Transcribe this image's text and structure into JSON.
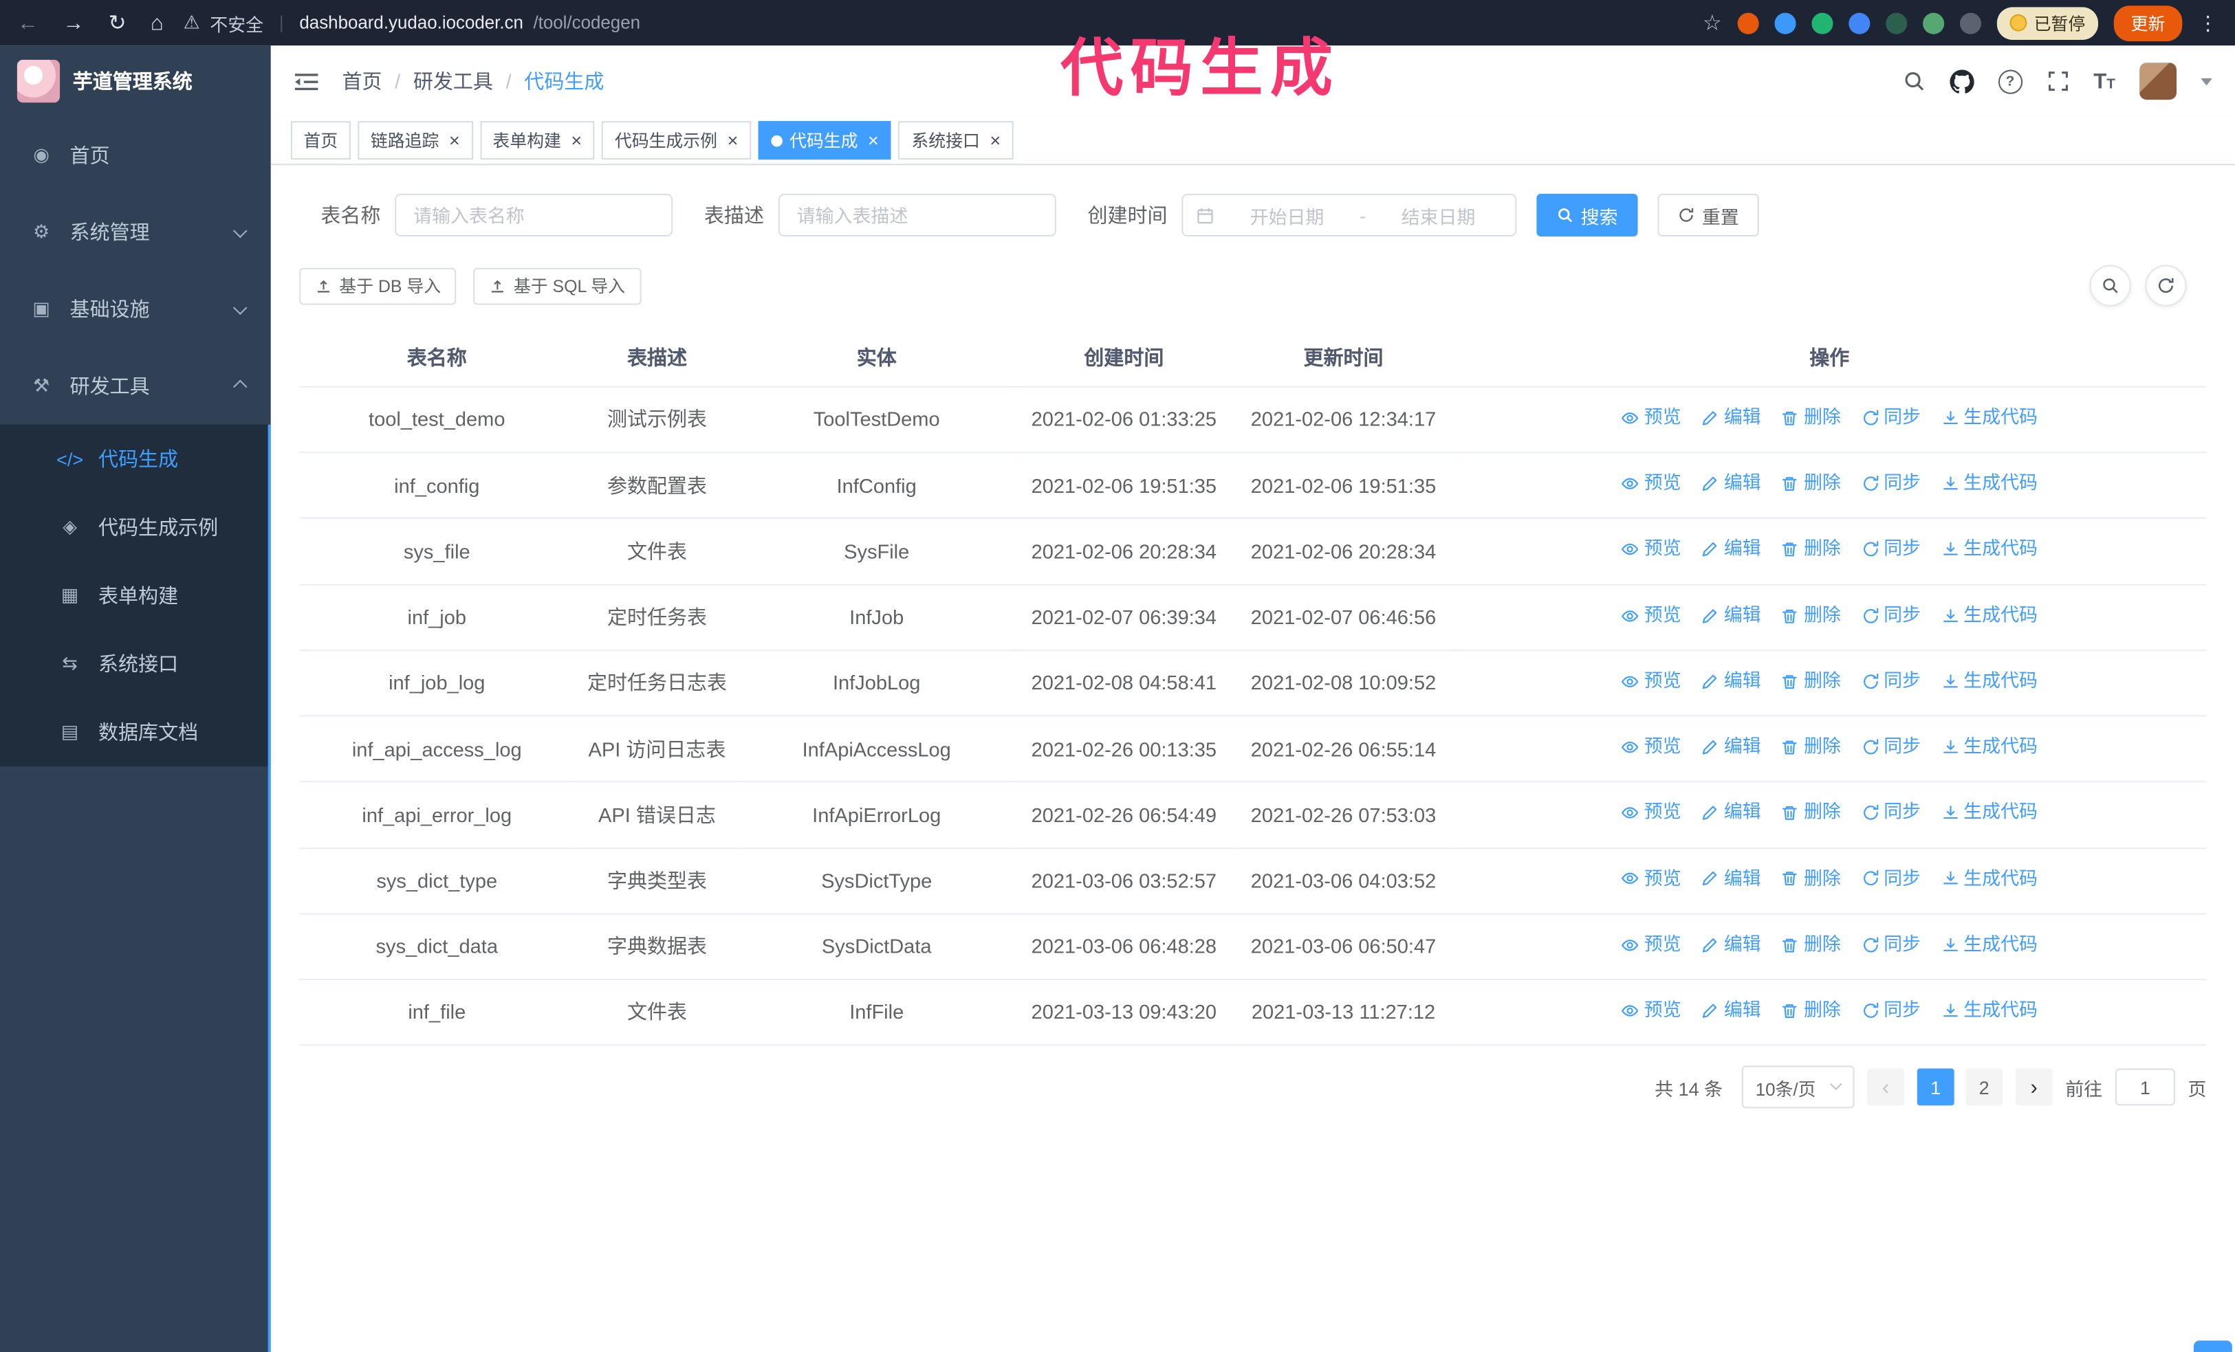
{
  "colors": {
    "accent": "#409eff",
    "annotation": "#f5386f",
    "sidebar_bg": "#304156",
    "submenu_bg": "#1f2d3d"
  },
  "annotation": {
    "text": "代码生成"
  },
  "browser": {
    "security_label": "不安全",
    "url_host": "dashboard.yudao.iocoder.cn",
    "url_path": "/tool/codegen",
    "paused_badge": "已暂停",
    "update_button": "更新"
  },
  "sidebar": {
    "logo_title": "芋道管理系统",
    "menu": [
      {
        "id": "home",
        "label": "首页",
        "icon": "home-icon",
        "type": "item"
      },
      {
        "id": "system",
        "label": "系统管理",
        "icon": "gear-icon",
        "type": "submenu-collapsed"
      },
      {
        "id": "infra",
        "label": "基础设施",
        "icon": "infra-icon",
        "type": "submenu-collapsed"
      },
      {
        "id": "devtools",
        "label": "研发工具",
        "icon": "tools-icon",
        "type": "submenu-expanded",
        "children": [
          {
            "id": "codegen",
            "label": "代码生成",
            "icon": "code-icon",
            "active": true
          },
          {
            "id": "codegen-demo",
            "label": "代码生成示例",
            "icon": "example-icon",
            "active": false
          },
          {
            "id": "form-build",
            "label": "表单构建",
            "icon": "form-icon",
            "active": false
          },
          {
            "id": "system-api",
            "label": "系统接口",
            "icon": "api-icon",
            "active": false
          },
          {
            "id": "db-doc",
            "label": "数据库文档",
            "icon": "db-doc-icon",
            "active": false
          }
        ]
      }
    ]
  },
  "header": {
    "breadcrumb": [
      "首页",
      "研发工具",
      "代码生成"
    ]
  },
  "tabs": [
    {
      "label": "首页",
      "closable": false,
      "active": false
    },
    {
      "label": "链路追踪",
      "closable": true,
      "active": false
    },
    {
      "label": "表单构建",
      "closable": true,
      "active": false
    },
    {
      "label": "代码生成示例",
      "closable": true,
      "active": false
    },
    {
      "label": "代码生成",
      "closable": true,
      "active": true
    },
    {
      "label": "系统接口",
      "closable": true,
      "active": false
    }
  ],
  "filters": {
    "table_name_label": "表名称",
    "table_name_placeholder": "请输入表名称",
    "table_desc_label": "表描述",
    "table_desc_placeholder": "请输入表描述",
    "create_time_label": "创建时间",
    "date_start_placeholder": "开始日期",
    "date_separator": "-",
    "date_end_placeholder": "结束日期",
    "search_button": "搜索",
    "reset_button": "重置"
  },
  "toolbar": {
    "import_db": "基于 DB 导入",
    "import_sql": "基于 SQL 导入"
  },
  "table": {
    "columns": [
      "表名称",
      "表描述",
      "实体",
      "创建时间",
      "更新时间",
      "操作"
    ],
    "actions": [
      "预览",
      "编辑",
      "删除",
      "同步",
      "生成代码"
    ],
    "rows": [
      {
        "name": "tool_test_demo",
        "desc": "测试示例表",
        "entity": "ToolTestDemo",
        "created": "2021-02-06 01:33:25",
        "updated": "2021-02-06 12:34:17"
      },
      {
        "name": "inf_config",
        "desc": "参数配置表",
        "entity": "InfConfig",
        "created": "2021-02-06 19:51:35",
        "updated": "2021-02-06 19:51:35"
      },
      {
        "name": "sys_file",
        "desc": "文件表",
        "entity": "SysFile",
        "created": "2021-02-06 20:28:34",
        "updated": "2021-02-06 20:28:34"
      },
      {
        "name": "inf_job",
        "desc": "定时任务表",
        "entity": "InfJob",
        "created": "2021-02-07 06:39:34",
        "updated": "2021-02-07 06:46:56"
      },
      {
        "name": "inf_job_log",
        "desc": "定时任务日志表",
        "entity": "InfJobLog",
        "created": "2021-02-08 04:58:41",
        "updated": "2021-02-08 10:09:52"
      },
      {
        "name": "inf_api_access_log",
        "desc": "API 访问日志表",
        "entity": "InfApiAccessLog",
        "created": "2021-02-26 00:13:35",
        "updated": "2021-02-26 06:55:14"
      },
      {
        "name": "inf_api_error_log",
        "desc": "API 错误日志",
        "entity": "InfApiErrorLog",
        "created": "2021-02-26 06:54:49",
        "updated": "2021-02-26 07:53:03"
      },
      {
        "name": "sys_dict_type",
        "desc": "字典类型表",
        "entity": "SysDictType",
        "created": "2021-03-06 03:52:57",
        "updated": "2021-03-06 04:03:52"
      },
      {
        "name": "sys_dict_data",
        "desc": "字典数据表",
        "entity": "SysDictData",
        "created": "2021-03-06 06:48:28",
        "updated": "2021-03-06 06:50:47"
      },
      {
        "name": "inf_file",
        "desc": "文件表",
        "entity": "InfFile",
        "created": "2021-03-13 09:43:20",
        "updated": "2021-03-13 11:27:12"
      }
    ]
  },
  "pagination": {
    "total": "共 14 条",
    "page_size": "10条/页",
    "pages": [
      "1",
      "2"
    ],
    "current_page": "1",
    "goto_label": "前往",
    "goto_value": "1",
    "goto_unit": "页"
  }
}
